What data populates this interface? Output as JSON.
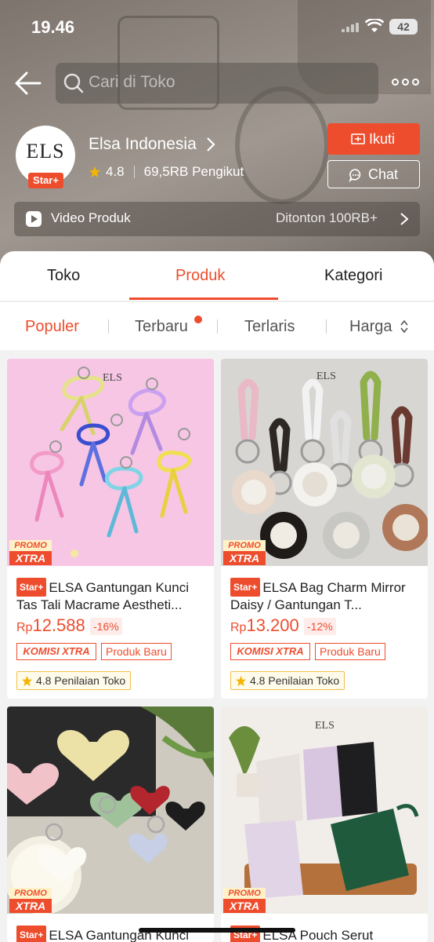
{
  "status_bar": {
    "time": "19.46",
    "battery": "42"
  },
  "search": {
    "placeholder": "Cari di Toko"
  },
  "shop": {
    "logo_text": "ELS",
    "badge": "Star+",
    "name": "Elsa Indonesia",
    "rating": "4.8",
    "followers": "69,5RB Pengikut",
    "follow_label": "Ikuti",
    "chat_label": "Chat"
  },
  "video": {
    "label": "Video Produk",
    "views": "Ditonton 100RB+"
  },
  "tabs": [
    {
      "label": "Toko"
    },
    {
      "label": "Produk",
      "active": true
    },
    {
      "label": "Kategori"
    }
  ],
  "sort": [
    {
      "label": "Populer",
      "active": true
    },
    {
      "label": "Terbaru",
      "dot": true
    },
    {
      "label": "Terlaris"
    },
    {
      "label": "Harga"
    }
  ],
  "products": [
    {
      "badge": "Star+",
      "promo_top": "PROMO",
      "promo_bottom": "XTRA",
      "title": "ELSA Gantungan Kunci Tas Tali Macrame Aestheti...",
      "price_currency": "Rp",
      "price": "12.588",
      "discount": "-16%",
      "komisi": "KOMISI XTRA",
      "tag": "Produk Baru",
      "shop_rating": "4.8 Penilaian Toko"
    },
    {
      "badge": "Star+",
      "promo_top": "PROMO",
      "promo_bottom": "XTRA",
      "title": "ELSA Bag Charm Mirror Daisy / Gantungan T...",
      "price_currency": "Rp",
      "price": "13.200",
      "discount": "-12%",
      "komisi": "KOMISI XTRA",
      "tag": "Produk Baru",
      "shop_rating": "4.8 Penilaian Toko"
    },
    {
      "badge": "Star+",
      "promo_top": "PROMO",
      "promo_bottom": "XTRA",
      "title": "ELSA Gantungan Kunci"
    },
    {
      "badge": "Star+",
      "promo_top": "PROMO",
      "promo_bottom": "XTRA",
      "title": "ELSA Pouch Serut",
      "image_logo": "ELS"
    }
  ],
  "colors": {
    "accent": "#ee4d2d",
    "rating_star": "#f5b400"
  }
}
